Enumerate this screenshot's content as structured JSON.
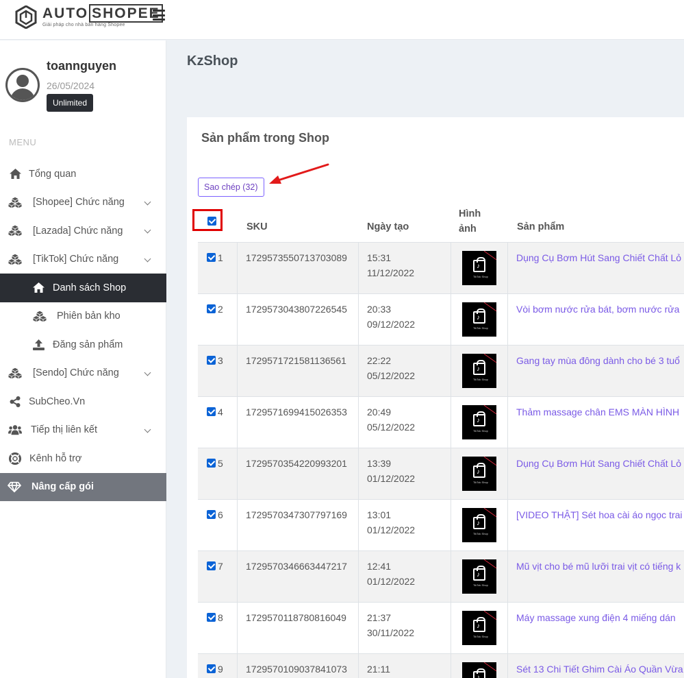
{
  "brand": {
    "name_plain": "AUTO",
    "name_boxed": "SHOPEE",
    "tagline": "Giải pháp cho nhà bán hàng Shopee"
  },
  "user": {
    "name": "toannguyen",
    "date": "26/05/2024",
    "plan": "Unlimited"
  },
  "menu": {
    "title": "MENU",
    "items": [
      {
        "label": "Tổng quan",
        "icon": "home-icon"
      },
      {
        "label": "[Shopee] Chức năng",
        "icon": "cubes-icon"
      },
      {
        "label": "[Lazada] Chức năng",
        "icon": "cubes-icon"
      },
      {
        "label": "[TikTok] Chức năng",
        "icon": "cubes-icon"
      },
      {
        "label": "Danh sách Shop",
        "icon": "home-icon"
      },
      {
        "label": "Phiên bản kho",
        "icon": "cubes-icon"
      },
      {
        "label": "Đăng sản phẩm",
        "icon": "upload-icon"
      },
      {
        "label": "[Sendo] Chức năng",
        "icon": "cubes-icon"
      },
      {
        "label": "SubCheo.Vn",
        "icon": "share-icon"
      },
      {
        "label": "Tiếp thị liên kết",
        "icon": "users-icon"
      },
      {
        "label": "Kênh hỗ trợ",
        "icon": "lifebuoy-icon"
      },
      {
        "label": "Nâng cấp gói",
        "icon": "diamond-icon"
      }
    ]
  },
  "page": {
    "title": "KzShop",
    "card_title": "Sản phẩm trong Shop",
    "copy_button": "Sao chép (32)"
  },
  "table": {
    "headers": {
      "sku": "SKU",
      "date": "Ngày tạo",
      "image_l1": "Hình",
      "image_l2": "ảnh",
      "product": "Sản phẩm"
    },
    "thumb_caption": "TikTok Shop",
    "rows": [
      {
        "n": "1",
        "sku": "1729573550713703089",
        "time": "15:31",
        "date": "11/12/2022",
        "product": "Dụng Cụ Bơm Hút Sang Chiết Chất Lỏ"
      },
      {
        "n": "2",
        "sku": "1729573043807226545",
        "time": "20:33",
        "date": "09/12/2022",
        "product": "Vòi bơm nước rửa bát, bơm nước rửa"
      },
      {
        "n": "3",
        "sku": "1729571721581136561",
        "time": "22:22",
        "date": "05/12/2022",
        "product": "Gang tay mùa đông dành cho bé 3 tuổ"
      },
      {
        "n": "4",
        "sku": "1729571699415026353",
        "time": "20:49",
        "date": "05/12/2022",
        "product": "Thảm massage chân EMS MÀN HÌNH"
      },
      {
        "n": "5",
        "sku": "1729570354220993201",
        "time": "13:39",
        "date": "01/12/2022",
        "product": "Dụng Cụ Bơm Hút Sang Chiết Chất Lỏ"
      },
      {
        "n": "6",
        "sku": "1729570347307797169",
        "time": "13:01",
        "date": "01/12/2022",
        "product": "[VIDEO THẬT] Sét hoa cài áo ngọc trai"
      },
      {
        "n": "7",
        "sku": "1729570346663447217",
        "time": "12:41",
        "date": "01/12/2022",
        "product": "Mũ vịt cho bé mũ lưỡi trai vịt có tiếng k"
      },
      {
        "n": "8",
        "sku": "1729570118780816049",
        "time": "21:37",
        "date": "30/11/2022",
        "product": "Máy massage xung điện 4 miếng dán"
      },
      {
        "n": "9",
        "sku": "1729570109037841073",
        "time": "21:11",
        "date": "",
        "product": "Sét 13 Chi Tiết Ghim Cài Áo Quần Vừa"
      }
    ]
  }
}
